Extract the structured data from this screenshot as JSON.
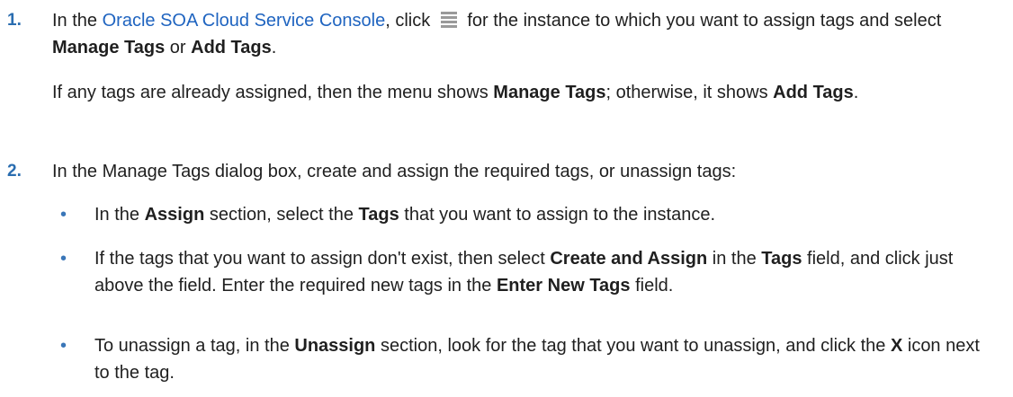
{
  "step1": {
    "number": "1.",
    "prefix": "In the ",
    "link": "Oracle SOA Cloud Service Console",
    "mid": ", click ",
    "icon": "menu-icon",
    "after_icon": " for the instance to which you want to assign tags and select ",
    "manage_tags": "Manage Tags",
    "or": " or ",
    "add_tags": "Add Tags",
    "end": ".",
    "note_prefix": "If any tags are already assigned, then the menu shows ",
    "note_manage": "Manage Tags",
    "note_mid": "; otherwise, it shows ",
    "note_add": "Add Tags",
    "note_end": "."
  },
  "step2": {
    "number": "2.",
    "text": "In the Manage Tags dialog box, create and assign the required tags, or unassign tags:",
    "bullets": [
      {
        "a": "In the ",
        "b1": "Assign",
        "c": " section, select the ",
        "b2": "Tags",
        "d": " that you want to assign to the instance."
      },
      {
        "a": "If the tags that you want to assign don't exist, then select ",
        "b1": "Create and Assign",
        "c": " in the ",
        "b2": "Tags",
        "d": " field, and click just above the field. Enter the required new tags in the ",
        "b3": "Enter New Tags",
        "e": " field."
      },
      {
        "a": "To unassign a tag, in the ",
        "b1": "Unassign",
        "c": " section, look for the tag that you want to unassign, and click the ",
        "b2": "X",
        "d": " icon next to the tag."
      }
    ],
    "bullet_glyph": "•"
  },
  "colors": {
    "link": "#1f64c0",
    "number": "#2a6db0",
    "text": "#1f1f1f"
  }
}
